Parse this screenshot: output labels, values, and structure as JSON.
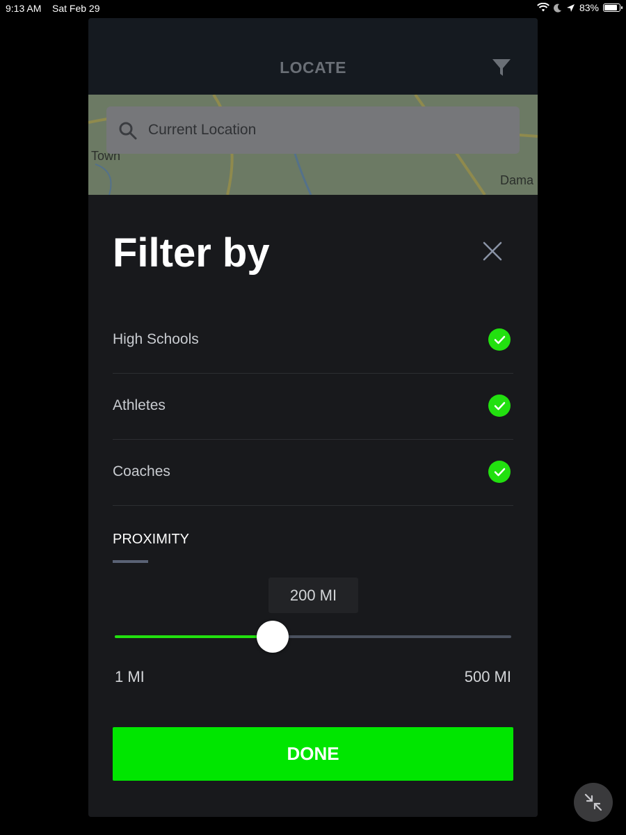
{
  "status_bar": {
    "time": "9:13 AM",
    "date": "Sat Feb 29",
    "battery_level": "83%"
  },
  "header": {
    "title": "LOCATE",
    "filter_icon": "filter-icon"
  },
  "map": {
    "search_placeholder": "Current Location",
    "labels": [
      "Town",
      "Dama"
    ]
  },
  "filter_sheet": {
    "title": "Filter by",
    "options": [
      {
        "label": "High Schools",
        "checked": true
      },
      {
        "label": "Athletes",
        "checked": true
      },
      {
        "label": "Coaches",
        "checked": true
      }
    ],
    "proximity": {
      "label": "PROXIMITY",
      "value_label": "200 MI",
      "value": 200,
      "min": 1,
      "max": 500,
      "min_label": "1 MI",
      "max_label": "500 MI"
    },
    "done_label": "DONE"
  },
  "colors": {
    "accent": "#00e600",
    "check": "#22e00f",
    "sheet_bg": "#18191c"
  }
}
